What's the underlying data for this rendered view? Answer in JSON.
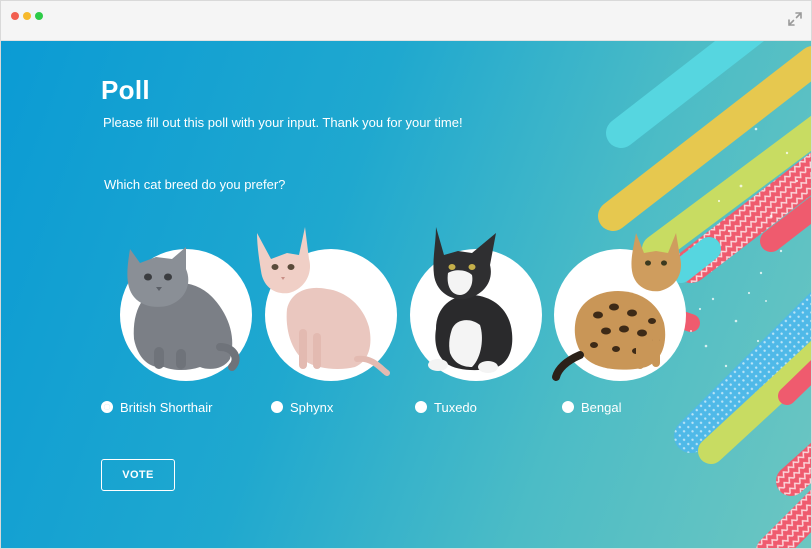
{
  "window": {
    "controls": [
      "close",
      "minimize",
      "maximize"
    ],
    "expand_icon": "expand-icon"
  },
  "poll": {
    "title": "Poll",
    "subtitle": "Please fill out this poll with your input. Thank you for your time!",
    "question": "Which cat breed do you prefer?",
    "options": [
      {
        "label": "British Shorthair",
        "selected": true,
        "image": "gray-kitten"
      },
      {
        "label": "Sphynx",
        "selected": false,
        "image": "hairless-cat"
      },
      {
        "label": "Tuxedo",
        "selected": false,
        "image": "black-white-kitten"
      },
      {
        "label": "Bengal",
        "selected": false,
        "image": "spotted-cat"
      }
    ],
    "vote_label": "VOTE"
  },
  "colors": {
    "background_start": "#0b9bd4",
    "background_end": "#6cc6c1",
    "accent_yellow": "#e6c84f",
    "accent_pink": "#ef5b6e",
    "accent_lime": "#c8dc62",
    "accent_cyan": "#56d6e0"
  }
}
